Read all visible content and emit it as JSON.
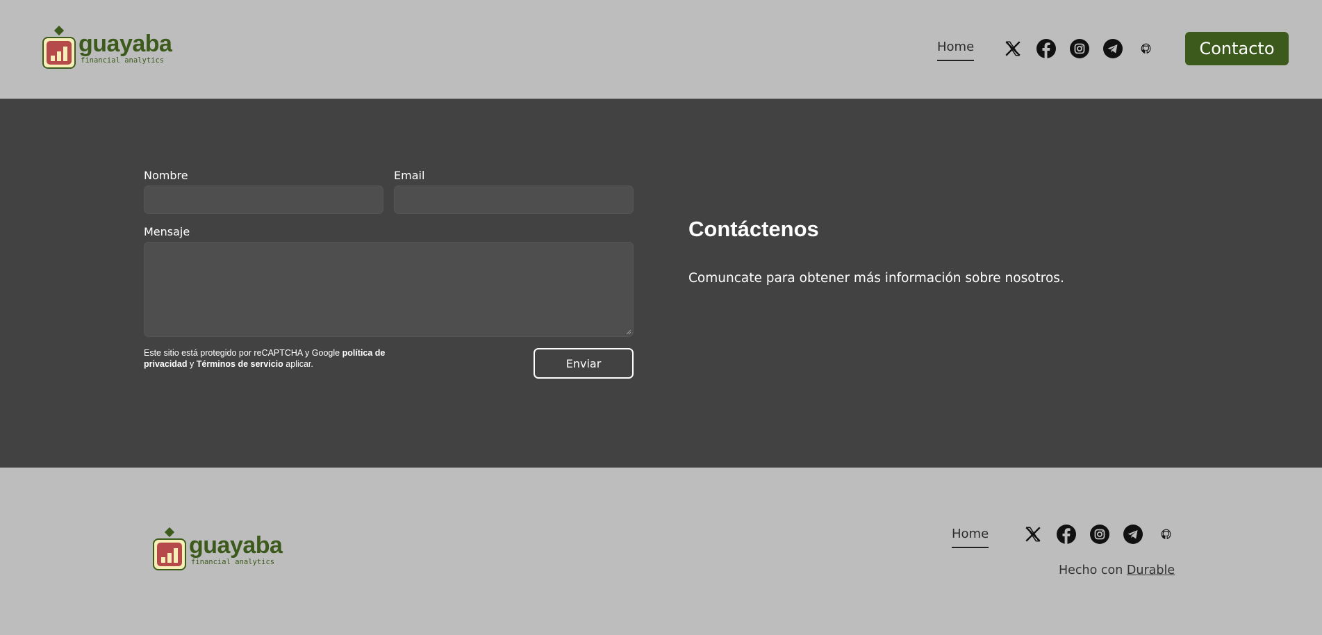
{
  "brand": {
    "name": "guayaba",
    "tagline": "financial analytics",
    "color": "#3c5a1b",
    "icon": "bar-chart-logo-icon"
  },
  "header": {
    "nav": {
      "home": "Home"
    },
    "socials": [
      "x-icon",
      "facebook-icon",
      "instagram-icon",
      "telegram-icon",
      "github-icon"
    ],
    "contact_button": "Contacto"
  },
  "form": {
    "name_label": "Nombre",
    "email_label": "Email",
    "message_label": "Mensaje",
    "recaptcha": {
      "prefix": "Este sitio está protegido por reCAPTCHA y Google ",
      "privacy_link": "política de privacidad",
      "middle": " y ",
      "terms_link": "Términos de servicio",
      "suffix": " aplicar."
    },
    "submit": "Enviar"
  },
  "contact": {
    "title": "Contáctenos",
    "description": "Comuncate para obtener más información sobre nosotros."
  },
  "footer": {
    "nav": {
      "home": "Home"
    },
    "made_with_prefix": "Hecho con ",
    "made_with_link": "Durable"
  },
  "colors": {
    "header_bg": "#bdbdbd",
    "main_bg": "#424242",
    "field_bg": "#4e4e4e",
    "accent": "#3c5a1b"
  }
}
